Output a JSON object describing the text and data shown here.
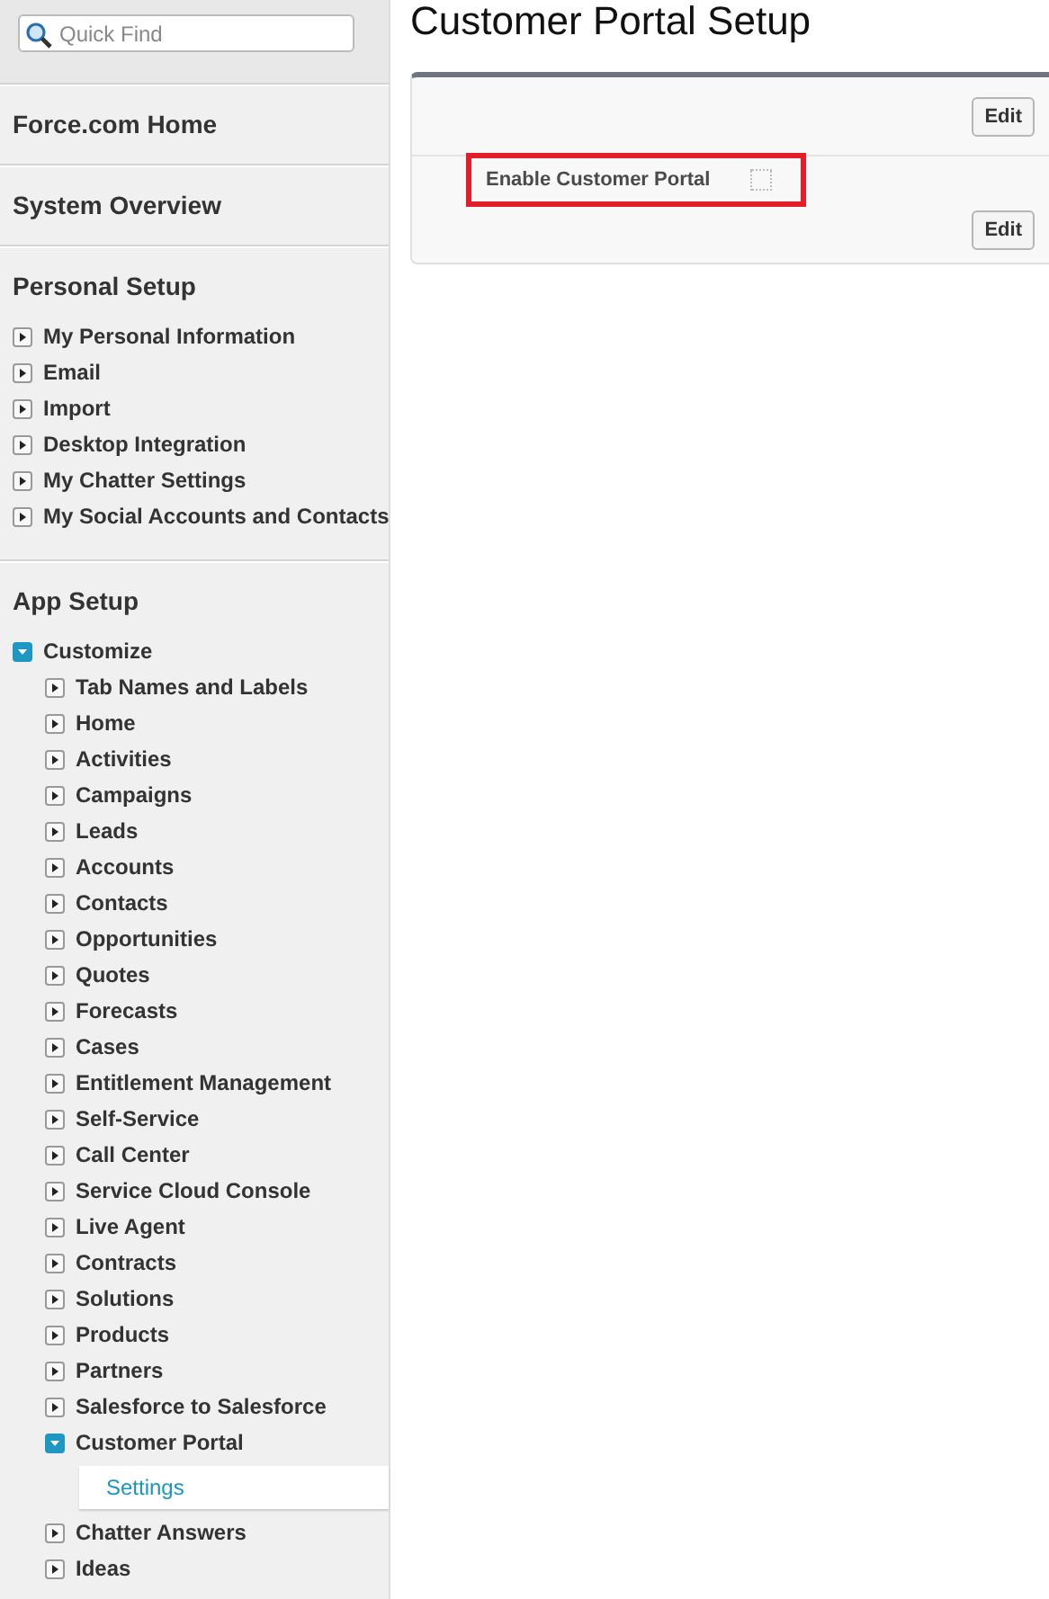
{
  "search": {
    "placeholder": "Quick Find"
  },
  "sections": [
    {
      "title": "Force.com Home"
    },
    {
      "title": "System Overview"
    },
    {
      "title": "Personal Setup",
      "items": [
        {
          "label": "My Personal Information",
          "expanded": false,
          "selected": false
        },
        {
          "label": "Email",
          "expanded": false,
          "selected": false
        },
        {
          "label": "Import",
          "expanded": false,
          "selected": false
        },
        {
          "label": "Desktop Integration",
          "expanded": false,
          "selected": false
        },
        {
          "label": "My Chatter Settings",
          "expanded": false,
          "selected": false
        },
        {
          "label": "My Social Accounts and Contacts",
          "expanded": false,
          "selected": false
        }
      ]
    },
    {
      "title": "App Setup",
      "items": [
        {
          "label": "Customize",
          "expanded": true,
          "selected": false,
          "children": [
            {
              "label": "Tab Names and Labels",
              "expanded": false,
              "selected": false
            },
            {
              "label": "Home",
              "expanded": false,
              "selected": false
            },
            {
              "label": "Activities",
              "expanded": false,
              "selected": false
            },
            {
              "label": "Campaigns",
              "expanded": false,
              "selected": false
            },
            {
              "label": "Leads",
              "expanded": false,
              "selected": false
            },
            {
              "label": "Accounts",
              "expanded": false,
              "selected": false
            },
            {
              "label": "Contacts",
              "expanded": false,
              "selected": false
            },
            {
              "label": "Opportunities",
              "expanded": false,
              "selected": false
            },
            {
              "label": "Quotes",
              "expanded": false,
              "selected": false
            },
            {
              "label": "Forecasts",
              "expanded": false,
              "selected": false
            },
            {
              "label": "Cases",
              "expanded": false,
              "selected": false
            },
            {
              "label": "Entitlement Management",
              "expanded": false,
              "selected": false
            },
            {
              "label": "Self-Service",
              "expanded": false,
              "selected": false
            },
            {
              "label": "Call Center",
              "expanded": false,
              "selected": false
            },
            {
              "label": "Service Cloud Console",
              "expanded": false,
              "selected": false
            },
            {
              "label": "Live Agent",
              "expanded": false,
              "selected": false
            },
            {
              "label": "Contracts",
              "expanded": false,
              "selected": false
            },
            {
              "label": "Solutions",
              "expanded": false,
              "selected": false
            },
            {
              "label": "Products",
              "expanded": false,
              "selected": false
            },
            {
              "label": "Partners",
              "expanded": false,
              "selected": false
            },
            {
              "label": "Salesforce to Salesforce",
              "expanded": false,
              "selected": false
            },
            {
              "label": "Customer Portal",
              "expanded": true,
              "selected": false,
              "children": [
                {
                  "label": "Settings",
                  "kind": "leaf",
                  "selected": true
                }
              ]
            },
            {
              "label": "Chatter Answers",
              "expanded": false,
              "selected": false
            },
            {
              "label": "Ideas",
              "expanded": false,
              "selected": false
            }
          ]
        }
      ]
    }
  ],
  "main": {
    "title": "Customer Portal Setup",
    "top_button": "Edit",
    "fields": [
      {
        "label": "Enable Customer Portal",
        "checked": false,
        "highlighted": true
      }
    ],
    "bottom_button": "Edit"
  }
}
